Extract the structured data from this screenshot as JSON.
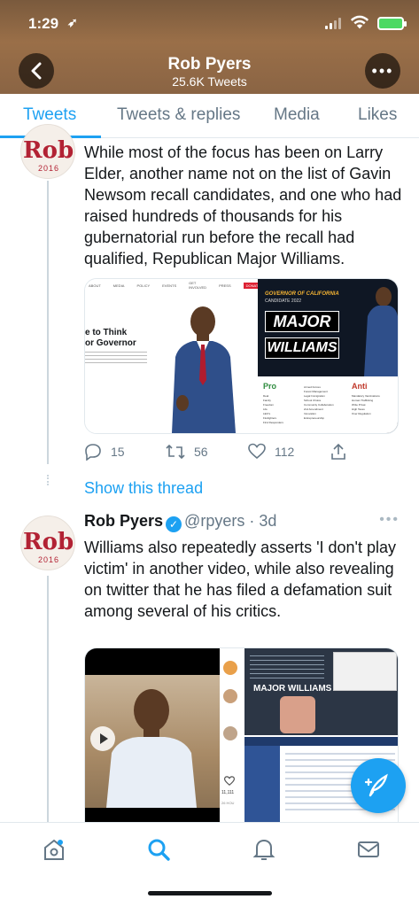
{
  "status_bar": {
    "time": "1:29",
    "location_glyph": "➶"
  },
  "header": {
    "back_icon": "arrow-left-icon",
    "name": "Rob Pyers",
    "tweet_count": "25.6K Tweets",
    "more_icon": "more-icon"
  },
  "tabs": [
    {
      "label": "Tweets",
      "active": true
    },
    {
      "label": "Tweets & replies",
      "active": false
    },
    {
      "label": "Media",
      "active": false
    },
    {
      "label": "Likes",
      "active": false
    }
  ],
  "avatar": {
    "text": "Rob!",
    "year": "2016"
  },
  "tweet1": {
    "text": "While most of the focus has been on Larry Elder, another name not on the list of Gavin Newsom recall candidates, and one who had raised hundreds of thousands for his gubernatorial run before the recall had qualified, Republican Major Williams.",
    "image_left": {
      "heading_line1": "e to Think",
      "heading_line2": "or Governor",
      "nav_items": [
        "ABOUT",
        "MEDIA",
        "POLICY",
        "EVENTS",
        "GET INVOLVED",
        "PRESS",
        "DONATE"
      ]
    },
    "image_right": {
      "governor_label": "GOVERNOR OF CALIFORNIA",
      "sub_label": "CANDIDATE 2022",
      "name_line1": "MAJOR",
      "name_line2": "WILLIAMS",
      "pro_label": "Pro",
      "anti_label": "Anti",
      "pro_items": [
        "Deal",
        "Family",
        "Freedom",
        "Life",
        "LEO's",
        "Firefighters",
        "First Responders"
      ],
      "pro_items2": [
        "Armed Forces",
        "Forest Management",
        "Legal Immigration",
        "School Choice",
        "Community Collaboration",
        "2nd Amendment",
        "Innovation",
        "Entrepreneurship"
      ],
      "anti_items": [
        "Mandatory Vaccinations",
        "Human Trafficking",
        "Write Privat",
        "High Taxes",
        "Over Regulation"
      ]
    },
    "reply_count": "15",
    "retweet_count": "56",
    "like_count": "112"
  },
  "show_thread_label": "Show this thread",
  "tweet2": {
    "name": "Rob Pyers",
    "handle": "@rpyers",
    "time": "3d",
    "text": "Williams also repeatedly asserts 'I don't play victim' in another video, while also revealing on twitter that he has filed a defamation suit among several of his critics.",
    "media_label": "MAJOR WILLIAMS",
    "media_count": "11,111",
    "media_time": "26 HOU"
  },
  "bottom_nav": {
    "items": [
      "home-icon",
      "search-icon",
      "notifications-icon",
      "messages-icon"
    ]
  },
  "colors": {
    "accent": "#1da1f2",
    "avatar_red": "#b22234"
  }
}
